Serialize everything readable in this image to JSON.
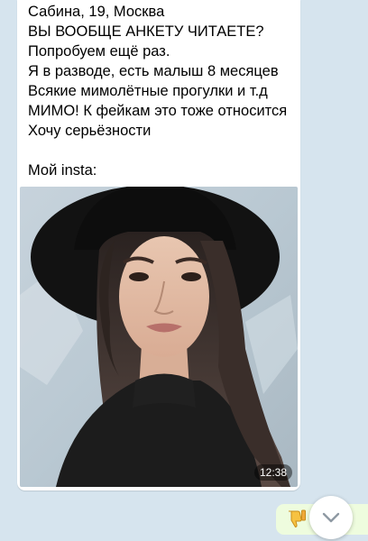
{
  "message": {
    "lines": [
      "Сабина, 19, Москва",
      "ВЫ ВООБЩЕ АНКЕТУ ЧИТАЕТЕ?",
      "Попробуем ещё раз.",
      "Я в разводе, есть малыш 8 месяцев",
      "Всякие мимолётные прогулки и т.д",
      "МИМО! К фейкам это тоже относится",
      "Хочу серьёзности",
      "",
      "Мой insta:"
    ],
    "photo_icon": "portrait-photo",
    "time": "12:38"
  },
  "reply": {
    "icon": "thumbs-down-emoji"
  },
  "scroll_button": {
    "icon": "chevron-down-icon"
  },
  "colors": {
    "chat_background": "#d6e4ee",
    "incoming_bubble": "#ffffff",
    "outgoing_bubble": "#eefcde"
  }
}
